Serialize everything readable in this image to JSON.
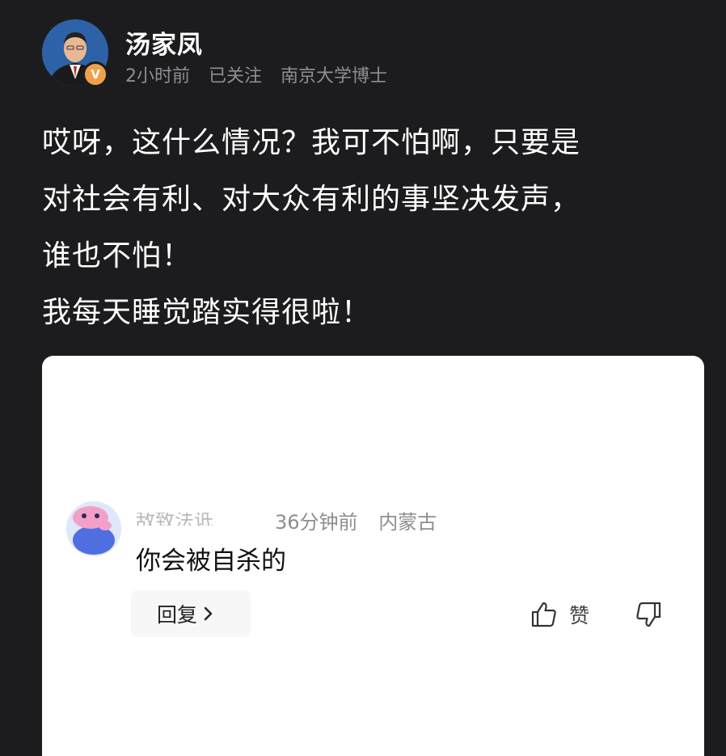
{
  "post": {
    "author": {
      "name": "汤家凤",
      "badge": "V",
      "badge_color": "#f0a04a",
      "avatar_icon": "person-in-suit-avatar"
    },
    "meta": {
      "time": "2小时前",
      "follow_status": "已关注",
      "description": "南京大学博士"
    },
    "body_lines": [
      "哎呀，这什么情况？我可不怕啊，只要是",
      "对社会有利、对大众有利的事坚决发声，",
      "谁也不怕！",
      "我每天睡觉踏实得很啦！"
    ]
  },
  "comment": {
    "author_partial": "敌致法诋",
    "time": "36分钟前",
    "location": "内蒙古",
    "text": "你会被自杀的",
    "reply_label": "回复",
    "like_label": "赞",
    "avatar_icon": "pink-creature-avatar"
  },
  "colors": {
    "background": "#1c1c1e",
    "card": "#ffffff",
    "meta_text": "#8e8e93"
  }
}
